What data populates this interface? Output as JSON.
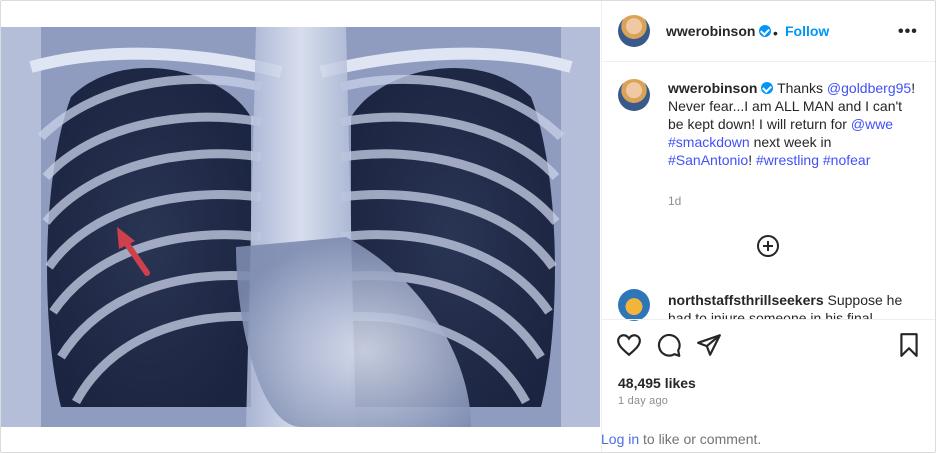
{
  "post": {
    "username": "wwerobinson",
    "follow_label": "Follow",
    "dot": "•",
    "more_label": "•••",
    "caption": {
      "username": "wwerobinson",
      "text_1": "Thanks",
      "mention": "@goldberg95",
      "text_2": "! Never fear...I am ALL MAN and I can't be kept down! I will return for",
      "mention_2": "@wwe",
      "hashtag_1": "#smackdown",
      "text_3": "next week in",
      "hashtag_2": "#SanAntonio",
      "text_4": "!",
      "hashtag_3": "#wrestling",
      "hashtag_4": "#nofear"
    },
    "age": "1d",
    "comment": {
      "username": "northstaffsthrillseekers",
      "text": "Suppose he had to injure someone in his final match..."
    },
    "likes": "48,495 likes",
    "posted": "1 day ago",
    "login_link": "Log in",
    "login_suffix": "to like or comment."
  },
  "icons": [
    "verified-badge",
    "more-options-icon",
    "add-comment-icon",
    "heart-icon",
    "comment-icon",
    "share-icon",
    "bookmark-icon"
  ],
  "colors": {
    "accent": "#0095f6",
    "link": "#4150f7",
    "muted": "#8e8e8e",
    "arrow": "#d0404c"
  }
}
